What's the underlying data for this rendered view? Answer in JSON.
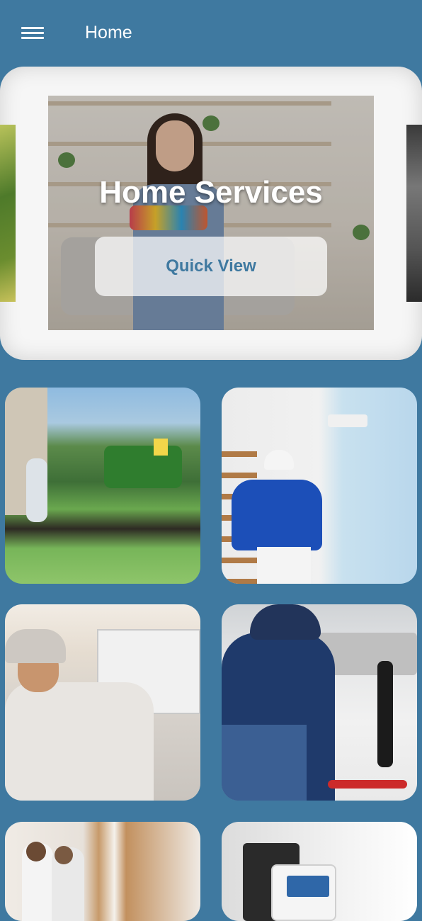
{
  "app_bar": {
    "title": "Home",
    "menu_icon": "hamburger-menu-icon"
  },
  "carousel": {
    "slide": {
      "title": "Home Services",
      "button_label": "Quick View"
    }
  },
  "service_tiles": [
    {
      "id": "landscaping"
    },
    {
      "id": "painting"
    },
    {
      "id": "ac-repair"
    },
    {
      "id": "plumbing"
    },
    {
      "id": "construction"
    },
    {
      "id": "electrical"
    }
  ],
  "colors": {
    "background": "#3f79a0",
    "accent": "#3f79a0",
    "card_bg": "#f6f6f6"
  }
}
